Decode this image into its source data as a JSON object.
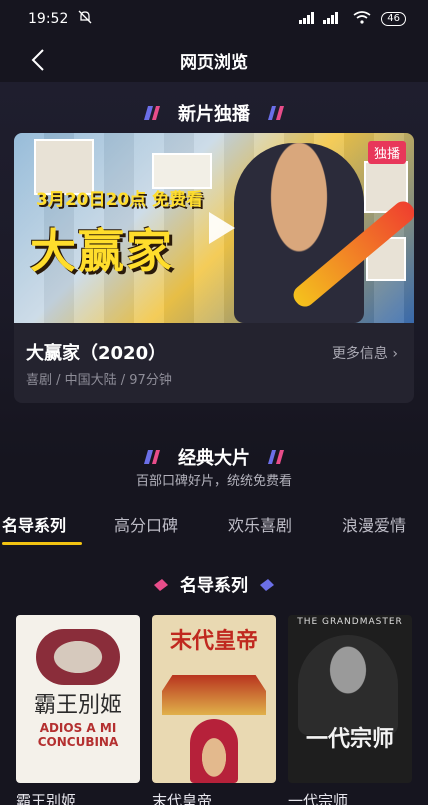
{
  "status": {
    "time": "19:52",
    "battery": "46",
    "signal": "HD 4G"
  },
  "nav": {
    "title": "网页浏览"
  },
  "featured": {
    "heading": "新片独播",
    "badge": "独播",
    "poster_date": "3月20日20点 免费看",
    "poster_title": "大赢家",
    "name": "大赢家（2020）",
    "more": "更多信息 ›",
    "meta": "喜剧 / 中国大陆  / 97分钟"
  },
  "classic": {
    "heading": "经典大片",
    "subtitle": "百部口碑好片，统统免费看"
  },
  "tabs": [
    "名导系列",
    "高分口碑",
    "欢乐喜剧",
    "浪漫爱情"
  ],
  "series": {
    "heading": "名导系列",
    "movies": [
      {
        "title": "霸王别姬",
        "poster_text": "霸王別姬",
        "poster_sub": "ADIOS A MI CONCUBINA"
      },
      {
        "title": "末代皇帝",
        "poster_text": "末代皇帝",
        "poster_sub": ""
      },
      {
        "title": "一代宗师",
        "poster_text": "一代宗师",
        "poster_sub": "THE GRANDMASTER"
      }
    ]
  },
  "colors": {
    "accent": "#f2c312",
    "badge": "#e8375a",
    "bg": "#16151f"
  }
}
